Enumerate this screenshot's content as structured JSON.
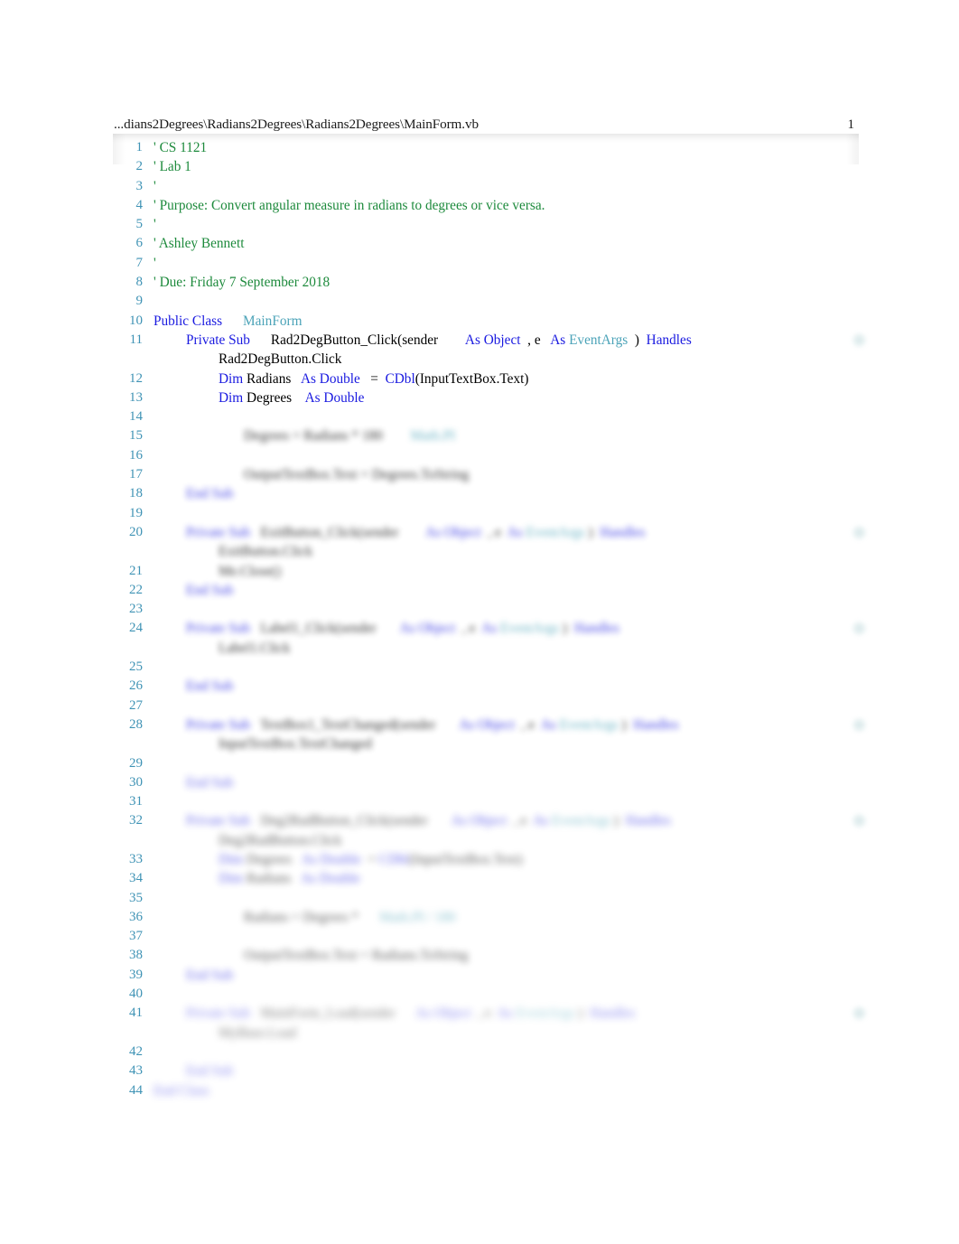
{
  "document": {
    "header_path": "...dians2Degrees\\Radians2Degrees\\Radians2Degrees\\MainForm.vb",
    "page_number": "1",
    "total_lines": "44"
  },
  "colors": {
    "comment": "#1d8a3c",
    "keyword": "#1a1ae0",
    "type": "#4ba3b8",
    "line_number": "#3f93b5",
    "plain": "#000000",
    "background": "#ffffff"
  },
  "lines": [
    {
      "n": "1",
      "blurred": false,
      "tokens": [
        {
          "t": "'",
          "c": "cm"
        },
        {
          "t": " CS 1121",
          "c": "cm"
        }
      ]
    },
    {
      "n": "2",
      "blurred": false,
      "tokens": [
        {
          "t": "' Lab 1",
          "c": "cm"
        }
      ]
    },
    {
      "n": "3",
      "blurred": false,
      "tokens": [
        {
          "t": "'",
          "c": "cm"
        }
      ]
    },
    {
      "n": "4",
      "blurred": false,
      "tokens": [
        {
          "t": "' Purpose: Convert angular measure in radians to degrees or vice versa.",
          "c": "cm"
        }
      ]
    },
    {
      "n": "5",
      "blurred": false,
      "tokens": [
        {
          "t": "'",
          "c": "cm"
        }
      ]
    },
    {
      "n": "6",
      "blurred": false,
      "tokens": [
        {
          "t": "' Ashley Bennett",
          "c": "cm"
        }
      ]
    },
    {
      "n": "7",
      "blurred": false,
      "tokens": [
        {
          "t": "'",
          "c": "cm"
        }
      ]
    },
    {
      "n": "8",
      "blurred": false,
      "tokens": [
        {
          "t": "' Due: Friday 7 September 2018",
          "c": "cm"
        }
      ]
    },
    {
      "n": "9",
      "blurred": false,
      "tokens": []
    },
    {
      "n": "10",
      "blurred": false,
      "tokens": [
        {
          "t": "Public Class",
          "c": "kw"
        },
        {
          "t": "      ",
          "c": "pl"
        },
        {
          "t": "MainForm",
          "c": "ty"
        }
      ]
    },
    {
      "n": "11",
      "blurred": false,
      "indent": 36,
      "edge_mark": true,
      "tokens": [
        {
          "t": "Private Sub",
          "c": "kw"
        },
        {
          "t": "      ",
          "c": "pl"
        },
        {
          "t": "Rad2DegButton_Click(sender",
          "c": "pl"
        },
        {
          "t": "        ",
          "c": "pl"
        },
        {
          "t": "As Object",
          "c": "kw"
        },
        {
          "t": "  , e",
          "c": "pl"
        },
        {
          "t": "   ",
          "c": "pl"
        },
        {
          "t": "As",
          "c": "kw"
        },
        {
          "t": " ",
          "c": "pl"
        },
        {
          "t": "EventArgs",
          "c": "ty"
        },
        {
          "t": "  )",
          "c": "pl"
        },
        {
          "t": "  ",
          "c": "pl"
        },
        {
          "t": "Handles",
          "c": "kw"
        },
        {
          "t": "\nRad2DegButton.Click",
          "c": "pl"
        }
      ]
    },
    {
      "n": "12",
      "blurred": false,
      "indent": 72,
      "tokens": [
        {
          "t": "Dim",
          "c": "kw"
        },
        {
          "t": " Radians",
          "c": "pl"
        },
        {
          "t": "   ",
          "c": "pl"
        },
        {
          "t": "As Double",
          "c": "kw"
        },
        {
          "t": "   =  ",
          "c": "pl"
        },
        {
          "t": "CDbl",
          "c": "kw"
        },
        {
          "t": "(InputTextBox.Text)",
          "c": "pl"
        }
      ]
    },
    {
      "n": "13",
      "blurred": false,
      "indent": 72,
      "tokens": [
        {
          "t": "Dim",
          "c": "kw"
        },
        {
          "t": " Degrees",
          "c": "pl"
        },
        {
          "t": "    ",
          "c": "pl"
        },
        {
          "t": "As Double",
          "c": "kw"
        }
      ]
    },
    {
      "n": "14",
      "blurred": true,
      "tokens": []
    },
    {
      "n": "15",
      "blurred": true,
      "indent": 100,
      "tokens": [
        {
          "t": "Degrees",
          "c": "pl"
        },
        {
          "t": " = Radians * 180 ",
          "c": "pl"
        },
        {
          "t": "       ",
          "c": "pl"
        },
        {
          "t": "Math.PI",
          "c": "ty"
        }
      ]
    },
    {
      "n": "16",
      "blurred": true,
      "tokens": []
    },
    {
      "n": "17",
      "blurred": true,
      "indent": 100,
      "tokens": [
        {
          "t": "OutputTextBox.Text = Degrees.ToString",
          "c": "pl"
        }
      ]
    },
    {
      "n": "18",
      "blurred": true,
      "indent": 36,
      "tokens": [
        {
          "t": "End Sub",
          "c": "kw"
        }
      ]
    },
    {
      "n": "19",
      "blurred": true,
      "tokens": []
    },
    {
      "n": "20",
      "blurred": true,
      "indent": 36,
      "edge_mark": true,
      "tokens": [
        {
          "t": "Private Sub",
          "c": "kw"
        },
        {
          "t": "   ",
          "c": "pl"
        },
        {
          "t": "ExitButton_Click(sender",
          "c": "pl"
        },
        {
          "t": "        ",
          "c": "pl"
        },
        {
          "t": "As Object",
          "c": "kw"
        },
        {
          "t": "  , e  ",
          "c": "pl"
        },
        {
          "t": "As",
          "c": "kw"
        },
        {
          "t": " ",
          "c": "pl"
        },
        {
          "t": "EventArgs",
          "c": "ty"
        },
        {
          "t": " )  ",
          "c": "pl"
        },
        {
          "t": "Handles",
          "c": "kw"
        },
        {
          "t": "\nExitButton.Click",
          "c": "pl"
        }
      ]
    },
    {
      "n": "21",
      "blurred": true,
      "indent": 72,
      "tokens": [
        {
          "t": "Me.Close()",
          "c": "pl"
        }
      ]
    },
    {
      "n": "22",
      "blurred": true,
      "indent": 36,
      "tokens": [
        {
          "t": "End Sub",
          "c": "kw"
        }
      ]
    },
    {
      "n": "23",
      "blurred": true,
      "tokens": []
    },
    {
      "n": "24",
      "blurred": true,
      "indent": 36,
      "edge_mark": true,
      "tokens": [
        {
          "t": "Private Sub",
          "c": "kw"
        },
        {
          "t": "   ",
          "c": "pl"
        },
        {
          "t": "Label1_Click(sender",
          "c": "pl"
        },
        {
          "t": "       ",
          "c": "pl"
        },
        {
          "t": "As Object",
          "c": "kw"
        },
        {
          "t": "  , e  ",
          "c": "pl"
        },
        {
          "t": "As",
          "c": "kw"
        },
        {
          "t": " ",
          "c": "pl"
        },
        {
          "t": "EventArgs",
          "c": "ty"
        },
        {
          "t": " )  ",
          "c": "pl"
        },
        {
          "t": "Handles",
          "c": "kw"
        },
        {
          "t": "\nLabel1.Click",
          "c": "pl"
        }
      ]
    },
    {
      "n": "25",
      "blurred": true,
      "tokens": []
    },
    {
      "n": "26",
      "blurred": true,
      "indent": 36,
      "tokens": [
        {
          "t": "End Sub",
          "c": "kw"
        }
      ]
    },
    {
      "n": "27",
      "blurred": true,
      "tokens": []
    },
    {
      "n": "28",
      "blurred": true,
      "indent": 36,
      "edge_mark": true,
      "tokens": [
        {
          "t": "Private Sub",
          "c": "kw"
        },
        {
          "t": "   ",
          "c": "pl"
        },
        {
          "t": "TextBox1_TextChanged(sender",
          "c": "pl"
        },
        {
          "t": "       ",
          "c": "pl"
        },
        {
          "t": "As Object",
          "c": "kw"
        },
        {
          "t": "  , e  ",
          "c": "pl"
        },
        {
          "t": "As",
          "c": "kw"
        },
        {
          "t": " ",
          "c": "pl"
        },
        {
          "t": "EventArgs",
          "c": "ty"
        },
        {
          "t": " )  ",
          "c": "pl"
        },
        {
          "t": "Handles",
          "c": "kw"
        },
        {
          "t": "\nInputTextBox.TextChanged",
          "c": "pl"
        }
      ]
    },
    {
      "n": "29",
      "blurred": true,
      "tokens": []
    },
    {
      "n": "30",
      "blurred": true,
      "indent": 36,
      "tokens": [
        {
          "t": "End Sub",
          "c": "kw"
        }
      ]
    },
    {
      "n": "31",
      "blurred": true,
      "tokens": []
    },
    {
      "n": "32",
      "blurred": true,
      "indent": 36,
      "edge_mark": true,
      "tokens": [
        {
          "t": "Private Sub",
          "c": "kw"
        },
        {
          "t": "   ",
          "c": "pl"
        },
        {
          "t": "Deg2RadButton_Click(sender",
          "c": "pl"
        },
        {
          "t": "       ",
          "c": "pl"
        },
        {
          "t": "As Object",
          "c": "kw"
        },
        {
          "t": "  , e  ",
          "c": "pl"
        },
        {
          "t": "As",
          "c": "kw"
        },
        {
          "t": " ",
          "c": "pl"
        },
        {
          "t": "EventArgs",
          "c": "ty"
        },
        {
          "t": " )  ",
          "c": "pl"
        },
        {
          "t": "Handles",
          "c": "kw"
        },
        {
          "t": "\nDeg2RadButton.Click",
          "c": "pl"
        }
      ]
    },
    {
      "n": "33",
      "blurred": true,
      "indent": 72,
      "tokens": [
        {
          "t": "Dim",
          "c": "kw"
        },
        {
          "t": " Degrees",
          "c": "pl"
        },
        {
          "t": "   ",
          "c": "pl"
        },
        {
          "t": "As Double",
          "c": "kw"
        },
        {
          "t": "  = ",
          "c": "pl"
        },
        {
          "t": "CDbl",
          "c": "kw"
        },
        {
          "t": "(InputTextBox.Text)",
          "c": "pl"
        }
      ]
    },
    {
      "n": "34",
      "blurred": true,
      "indent": 72,
      "tokens": [
        {
          "t": "Dim",
          "c": "kw"
        },
        {
          "t": " Radians",
          "c": "pl"
        },
        {
          "t": "   ",
          "c": "pl"
        },
        {
          "t": "As Double",
          "c": "kw"
        }
      ]
    },
    {
      "n": "35",
      "blurred": true,
      "tokens": []
    },
    {
      "n": "36",
      "blurred": true,
      "indent": 100,
      "tokens": [
        {
          "t": "Radians = Degrees * ",
          "c": "pl"
        },
        {
          "t": "     ",
          "c": "pl"
        },
        {
          "t": "Math.PI / 180",
          "c": "ty"
        }
      ]
    },
    {
      "n": "37",
      "blurred": true,
      "tokens": []
    },
    {
      "n": "38",
      "blurred": true,
      "indent": 100,
      "tokens": [
        {
          "t": "OutputTextBox.Text = Radians.ToString",
          "c": "pl"
        }
      ]
    },
    {
      "n": "39",
      "blurred": true,
      "indent": 36,
      "tokens": [
        {
          "t": "End Sub",
          "c": "kw"
        }
      ]
    },
    {
      "n": "40",
      "blurred": true,
      "tokens": []
    },
    {
      "n": "41",
      "blurred": true,
      "indent": 36,
      "edge_mark": true,
      "tokens": [
        {
          "t": "Private Sub",
          "c": "kw"
        },
        {
          "t": "   ",
          "c": "pl"
        },
        {
          "t": "MainForm_Load(sender",
          "c": "pl"
        },
        {
          "t": "      ",
          "c": "pl"
        },
        {
          "t": "As Object",
          "c": "kw"
        },
        {
          "t": "  , e  ",
          "c": "pl"
        },
        {
          "t": "As",
          "c": "kw"
        },
        {
          "t": " ",
          "c": "pl"
        },
        {
          "t": "EventArgs",
          "c": "ty"
        },
        {
          "t": " )  ",
          "c": "pl"
        },
        {
          "t": "Handles",
          "c": "kw"
        },
        {
          "t": "\nMyBase.Load",
          "c": "pl"
        }
      ]
    },
    {
      "n": "42",
      "blurred": true,
      "tokens": []
    },
    {
      "n": "43",
      "blurred": true,
      "indent": 36,
      "tokens": [
        {
          "t": "End Sub",
          "c": "kw"
        }
      ]
    },
    {
      "n": "44",
      "blurred": true,
      "indent": 0,
      "tokens": [
        {
          "t": "End Class",
          "c": "kw"
        }
      ]
    }
  ]
}
